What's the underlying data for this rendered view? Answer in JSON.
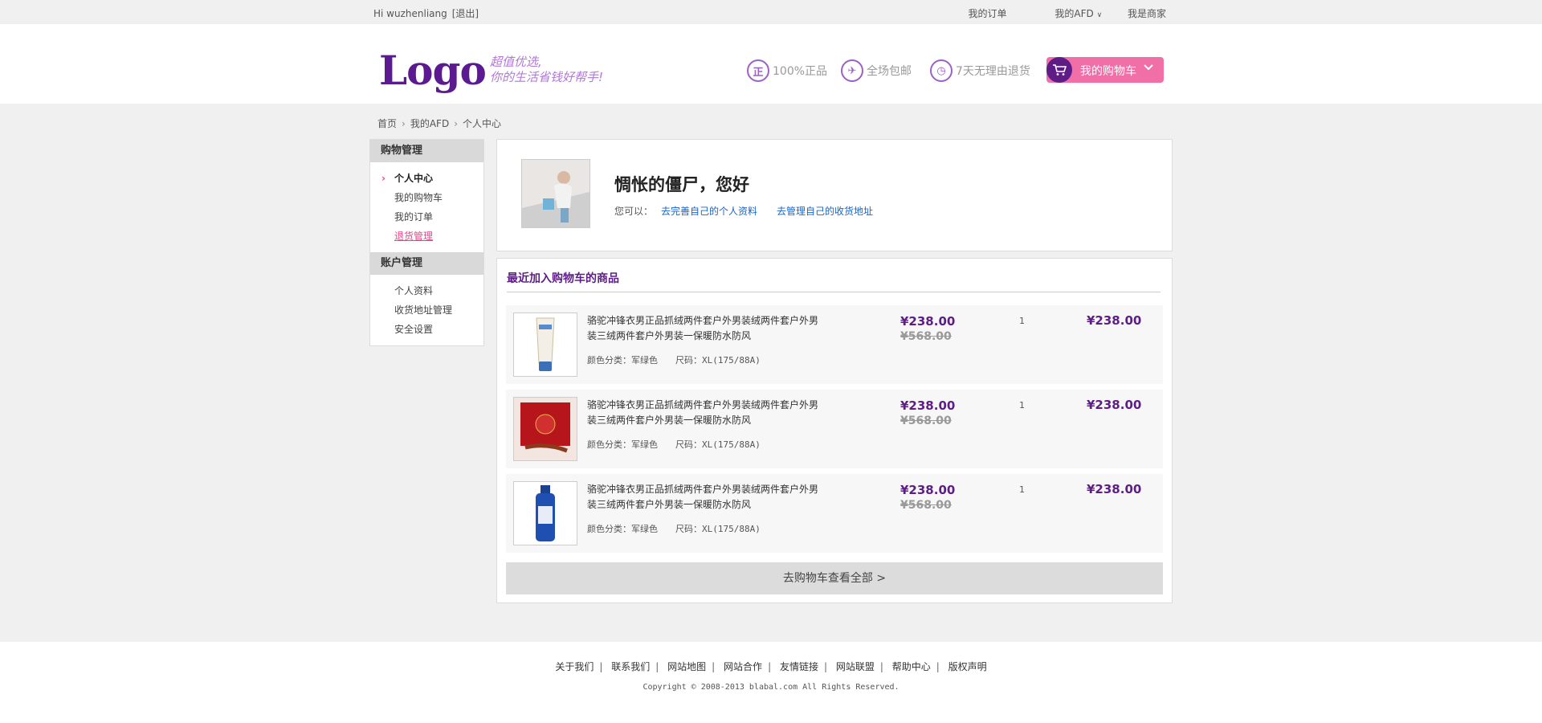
{
  "topbar": {
    "greeting": "Hi wuzhenliang",
    "logout": "[退出]",
    "my_orders": "我的订单",
    "my_afd": "我的AFD",
    "merchant": "我是商家"
  },
  "header": {
    "logo": "Logo",
    "slogan_line1": "超值优选,",
    "slogan_line2": "你的生活省钱好帮手!",
    "features": [
      {
        "icon": "genuine-icon",
        "glyph": "正",
        "label": "100%正品"
      },
      {
        "icon": "shipping-icon",
        "glyph": "✈",
        "label": "全场包邮"
      },
      {
        "icon": "clock-icon",
        "glyph": "◷",
        "label": "7天无理由退货"
      }
    ],
    "cart_label": "我的购物车"
  },
  "breadcrumb": [
    "首页",
    "我的AFD",
    "个人中心"
  ],
  "sidebar": {
    "shopping_header": "购物管理",
    "shopping_items": [
      "个人中心",
      "我的购物车",
      "我的订单",
      "退货管理"
    ],
    "account_header": "账户管理",
    "account_items": [
      "个人资料",
      "收货地址管理",
      "安全设置"
    ]
  },
  "profile": {
    "hello": "惆怅的僵尸，您好",
    "can_label": "您可以：",
    "link_profile": "去完善自己的个人资料",
    "link_address": "去管理自己的收货地址"
  },
  "recent": {
    "title": "最近加入购物车的商品",
    "items": [
      {
        "name": "骆驼冲锋衣男正品抓绒两件套户外男装绒两件套户外男装三绒两件套户外男装一保暖防水防风",
        "color": "颜色分类：军绿色",
        "size": "尺码：XL(175/88A)",
        "price": "¥238.00",
        "original_price": "¥568.00",
        "qty": "1",
        "total": "¥238.00",
        "thumb": "lotion-tube"
      },
      {
        "name": "骆驼冲锋衣男正品抓绒两件套户外男装绒两件套户外男装三绒两件套户外男装一保暖防水防风",
        "color": "颜色分类：军绿色",
        "size": "尺码：XL(175/88A)",
        "price": "¥238.00",
        "original_price": "¥568.00",
        "qty": "1",
        "total": "¥238.00",
        "thumb": "red-gift-box"
      },
      {
        "name": "骆驼冲锋衣男正品抓绒两件套户外男装绒两件套户外男装三绒两件套户外男装一保暖防水防风",
        "color": "颜色分类：军绿色",
        "size": "尺码：XL(175/88A)",
        "price": "¥238.00",
        "original_price": "¥568.00",
        "qty": "1",
        "total": "¥238.00",
        "thumb": "blue-bottle"
      }
    ],
    "view_all": "去购物车查看全部  >"
  },
  "footer": {
    "links": [
      "关于我们",
      "联系我们",
      "网站地图",
      "网站合作",
      "友情链接",
      "网站联盟",
      "帮助中心",
      "版权声明"
    ],
    "copyright": "Copyright © 2008-2013 blabal.com All Rights Reserved."
  },
  "colors": {
    "brand_purple": "#5e1d86",
    "accent_pink": "#f06fa6",
    "link_blue": "#1a64c8"
  }
}
